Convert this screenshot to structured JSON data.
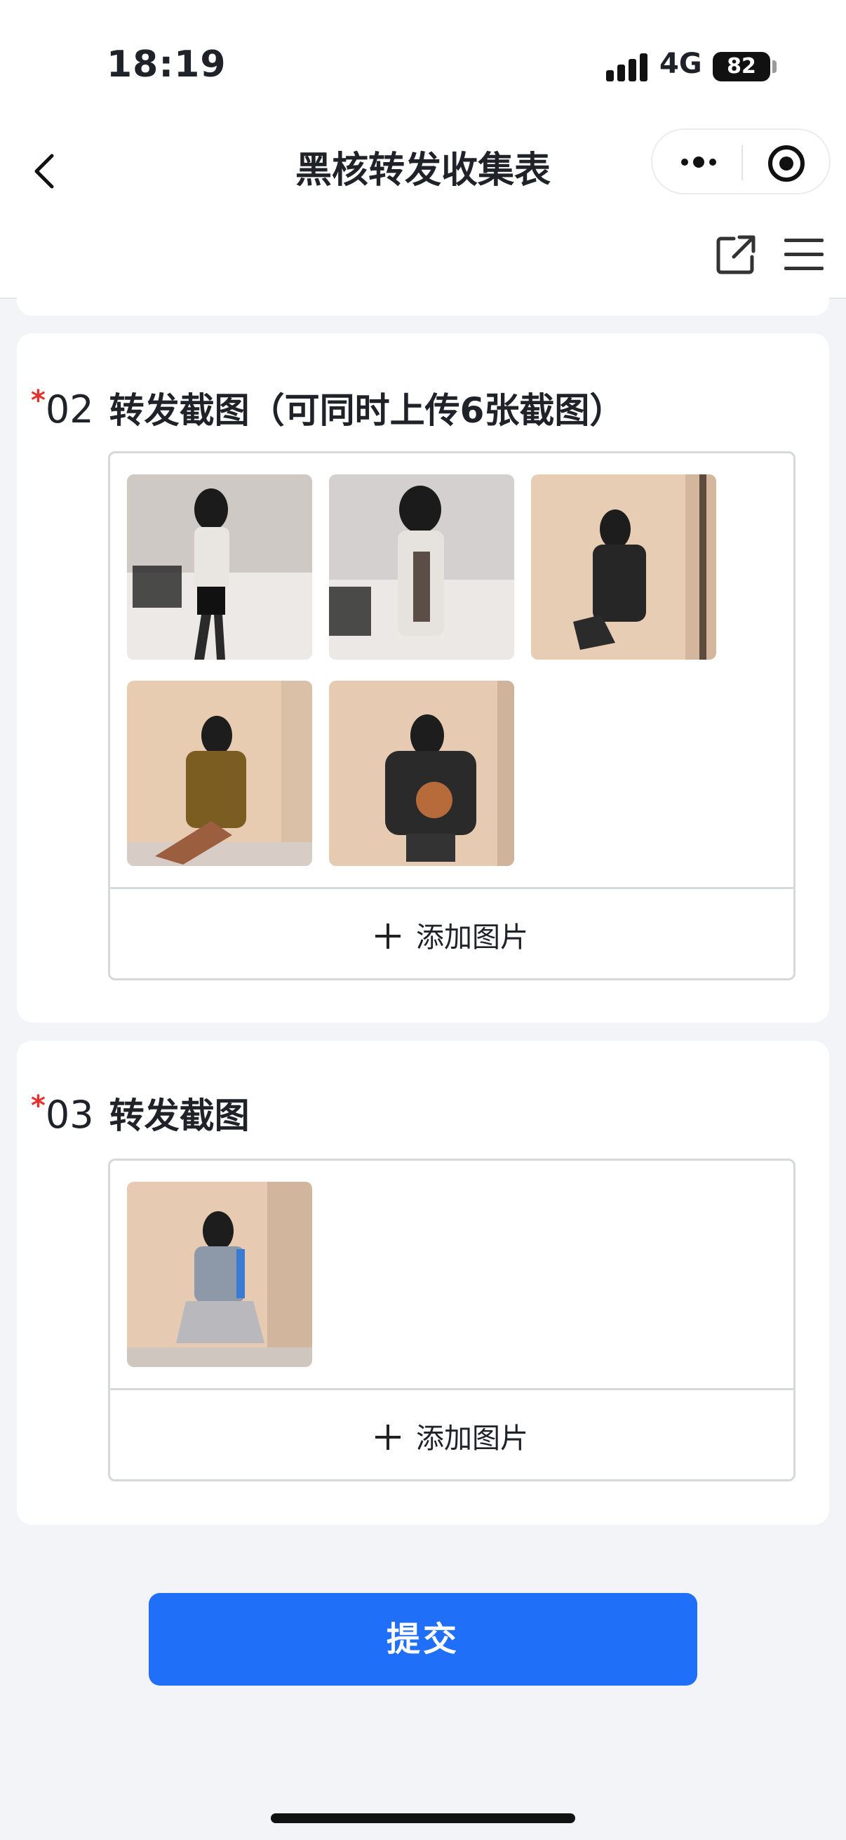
{
  "status_bar": {
    "time": "18:19",
    "network": "4G",
    "battery": "82"
  },
  "nav": {
    "title": "黑核转发收集表"
  },
  "questions": [
    {
      "number": "02",
      "required_mark": "*",
      "title": "转发截图（可同时上传6张截图）",
      "add_label": "添加图片",
      "images": [
        "photo-1",
        "photo-2",
        "photo-3",
        "photo-4",
        "photo-5"
      ]
    },
    {
      "number": "03",
      "required_mark": "*",
      "title": "转发截图",
      "add_label": "添加图片",
      "images": [
        "photo-6"
      ]
    }
  ],
  "submit_label": "提交",
  "colors": {
    "accent": "#1f6ff8",
    "required": "#e5312c",
    "background": "#f3f4f7"
  },
  "icons": [
    "back-arrow-icon",
    "more-dots-icon",
    "target-icon",
    "share-icon",
    "menu-icon",
    "plus-icon"
  ]
}
